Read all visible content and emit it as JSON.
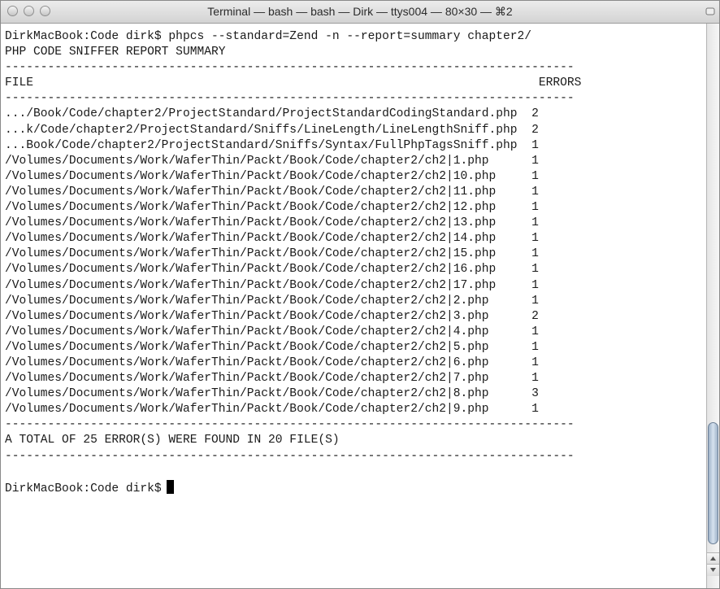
{
  "window": {
    "title": "Terminal — bash — bash — Dirk — ttys004 — 80×30 — ⌘2"
  },
  "terminal": {
    "lines": [
      "DirkMacBook:Code dirk$ phpcs --standard=Zend -n --report=summary chapter2/",
      "PHP CODE SNIFFER REPORT SUMMARY",
      "--------------------------------------------------------------------------------",
      "FILE                                                                       ERRORS",
      "--------------------------------------------------------------------------------",
      ".../Book/Code/chapter2/ProjectStandard/ProjectStandardCodingStandard.php  2",
      "...k/Code/chapter2/ProjectStandard/Sniffs/LineLength/LineLengthSniff.php  2",
      "...Book/Code/chapter2/ProjectStandard/Sniffs/Syntax/FullPhpTagsSniff.php  1",
      "/Volumes/Documents/Work/WaferThin/Packt/Book/Code/chapter2/ch2|1.php      1",
      "/Volumes/Documents/Work/WaferThin/Packt/Book/Code/chapter2/ch2|10.php     1",
      "/Volumes/Documents/Work/WaferThin/Packt/Book/Code/chapter2/ch2|11.php     1",
      "/Volumes/Documents/Work/WaferThin/Packt/Book/Code/chapter2/ch2|12.php     1",
      "/Volumes/Documents/Work/WaferThin/Packt/Book/Code/chapter2/ch2|13.php     1",
      "/Volumes/Documents/Work/WaferThin/Packt/Book/Code/chapter2/ch2|14.php     1",
      "/Volumes/Documents/Work/WaferThin/Packt/Book/Code/chapter2/ch2|15.php     1",
      "/Volumes/Documents/Work/WaferThin/Packt/Book/Code/chapter2/ch2|16.php     1",
      "/Volumes/Documents/Work/WaferThin/Packt/Book/Code/chapter2/ch2|17.php     1",
      "/Volumes/Documents/Work/WaferThin/Packt/Book/Code/chapter2/ch2|2.php      1",
      "/Volumes/Documents/Work/WaferThin/Packt/Book/Code/chapter2/ch2|3.php      2",
      "/Volumes/Documents/Work/WaferThin/Packt/Book/Code/chapter2/ch2|4.php      1",
      "/Volumes/Documents/Work/WaferThin/Packt/Book/Code/chapter2/ch2|5.php      1",
      "/Volumes/Documents/Work/WaferThin/Packt/Book/Code/chapter2/ch2|6.php      1",
      "/Volumes/Documents/Work/WaferThin/Packt/Book/Code/chapter2/ch2|7.php      1",
      "/Volumes/Documents/Work/WaferThin/Packt/Book/Code/chapter2/ch2|8.php      3",
      "/Volumes/Documents/Work/WaferThin/Packt/Book/Code/chapter2/ch2|9.php      1",
      "--------------------------------------------------------------------------------",
      "A TOTAL OF 25 ERROR(S) WERE FOUND IN 20 FILE(S)",
      "--------------------------------------------------------------------------------",
      "",
      "DirkMacBook:Code dirk$"
    ]
  }
}
